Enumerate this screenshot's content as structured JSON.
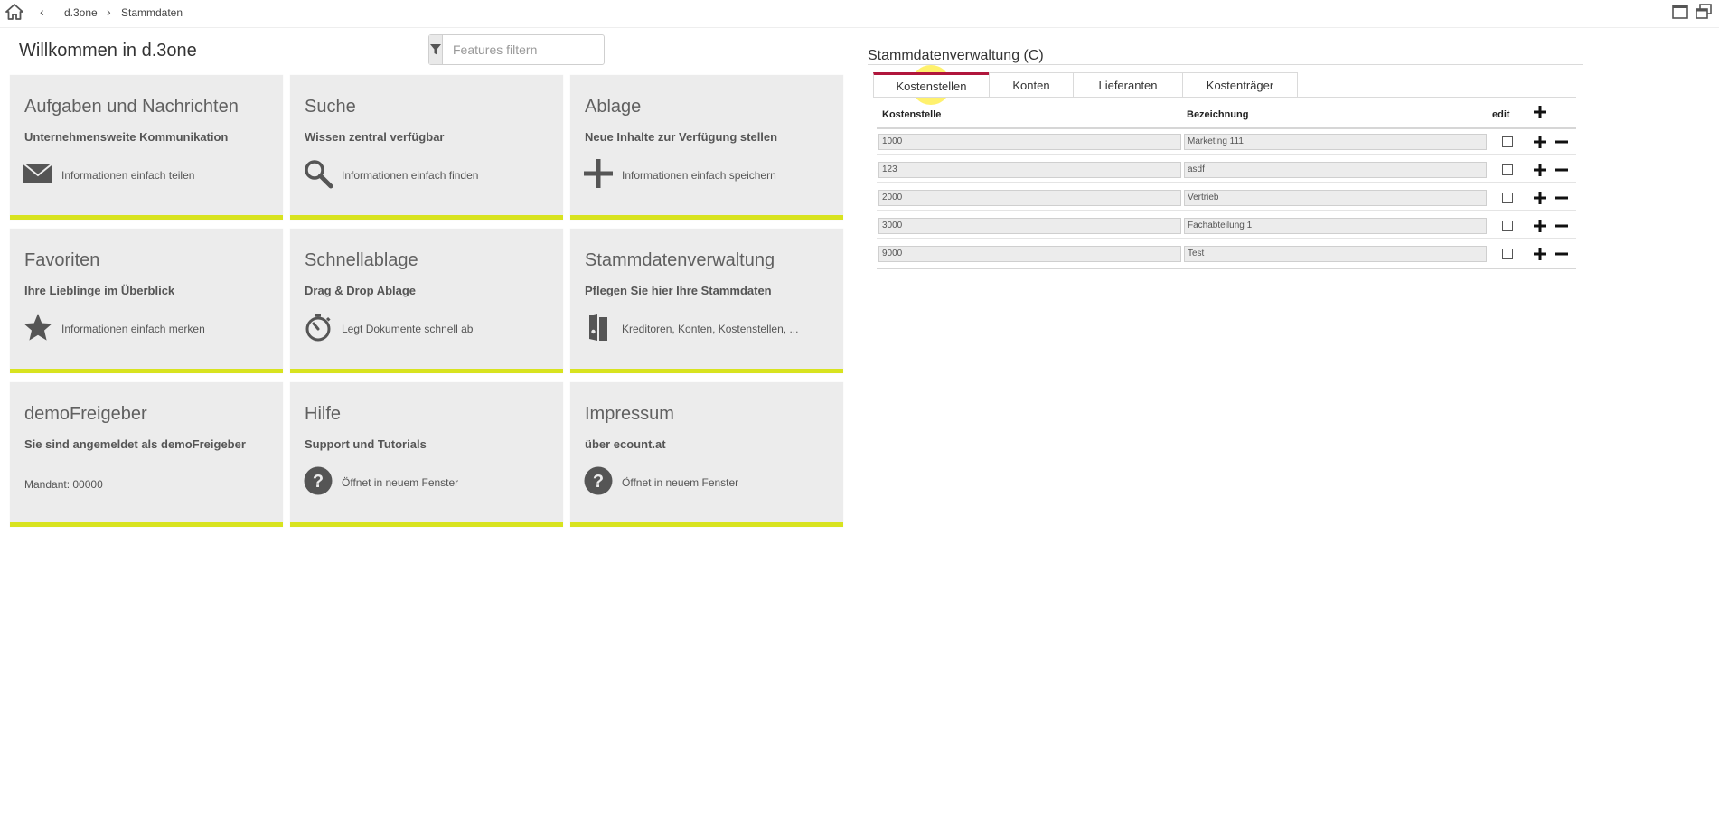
{
  "breadcrumb": {
    "back": "‹",
    "item1": "d.3one",
    "separator": "›",
    "item2": "Stammdaten"
  },
  "welcome": "Willkommen in d.3one",
  "filter": {
    "placeholder": "Features filtern"
  },
  "tiles": [
    {
      "title": "Aufgaben und Nachrichten",
      "subtitle": "Unternehmensweite Kommunikation",
      "desc": "Informationen einfach teilen",
      "icon": "envelope-icon"
    },
    {
      "title": "Suche",
      "subtitle": "Wissen zentral verfügbar",
      "desc": "Informationen einfach finden",
      "icon": "search-icon"
    },
    {
      "title": "Ablage",
      "subtitle": "Neue Inhalte zur Verfügung stellen",
      "desc": "Informationen einfach speichern",
      "icon": "plus-icon"
    },
    {
      "title": "Favoriten",
      "subtitle": "Ihre Lieblinge im Überblick",
      "desc": "Informationen einfach merken",
      "icon": "star-icon"
    },
    {
      "title": "Schnellablage",
      "subtitle": "Drag & Drop Ablage",
      "desc": "Legt Dokumente schnell ab",
      "icon": "stopwatch-icon"
    },
    {
      "title": "Stammdatenverwaltung",
      "subtitle": "Pflegen Sie hier Ihre Stammdaten",
      "desc": "Kreditoren, Konten, Kostenstellen, ...",
      "icon": "binder-icon"
    },
    {
      "title": "demoFreigeber",
      "subtitle": "Sie sind angemeldet als demoFreigeber",
      "desc": "Mandant: 00000",
      "icon": ""
    },
    {
      "title": "Hilfe",
      "subtitle": "Support und Tutorials",
      "desc": "Öffnet in neuem Fenster",
      "icon": "help-icon"
    },
    {
      "title": "Impressum",
      "subtitle": "über ecount.at",
      "desc": "Öffnet in neuem Fenster",
      "icon": "help-icon"
    }
  ],
  "panel": {
    "title": "Stammdatenverwaltung (C)",
    "tabs": [
      "Kostenstellen",
      "Konten",
      "Lieferanten",
      "Kostenträger"
    ],
    "active_tab": "Kostenstellen",
    "columns": {
      "col1": "Kostenstelle",
      "col2": "Bezeichnung",
      "col3": "edit"
    },
    "rows": [
      {
        "code": "1000",
        "name": "Marketing 111",
        "edit": false
      },
      {
        "code": "123",
        "name": "asdf",
        "edit": false
      },
      {
        "code": "2000",
        "name": "Vertrieb",
        "edit": false
      },
      {
        "code": "3000",
        "name": "Fachabteilung 1",
        "edit": false
      },
      {
        "code": "9000",
        "name": "Test",
        "edit": false
      }
    ]
  },
  "colors": {
    "accent_bar": "#d8e31f",
    "active_tab": "#b0163c",
    "tile_bg": "#ececec",
    "cursor_highlight": "#ffec3c"
  }
}
